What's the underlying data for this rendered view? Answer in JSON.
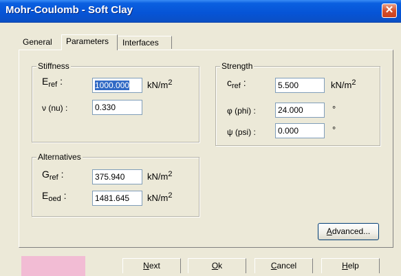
{
  "window": {
    "title": "Mohr-Coulomb - Soft Clay",
    "close_glyph": "✕"
  },
  "tabs": [
    {
      "label": "General"
    },
    {
      "label": "Parameters",
      "active": true
    },
    {
      "label": "Interfaces"
    }
  ],
  "stiffness": {
    "title": "Stiffness",
    "e_ref": {
      "symbol": "E",
      "sub": "ref",
      "value": "1000.000",
      "unit": "kN/m",
      "exp": "2"
    },
    "nu": {
      "label": "ν (nu) :",
      "value": "0.330"
    }
  },
  "strength": {
    "title": "Strength",
    "c_ref": {
      "symbol": "c",
      "sub": "ref",
      "value": "5.500",
      "unit": "kN/m",
      "exp": "2"
    },
    "phi": {
      "label": "φ (phi) :",
      "value": "24.000",
      "unit": "°"
    },
    "psi": {
      "label": "ψ (psi) :",
      "value": "0.000",
      "unit": "°"
    }
  },
  "alternatives": {
    "title": "Alternatives",
    "g_ref": {
      "symbol": "G",
      "sub": "ref",
      "value": "375.940",
      "unit": "kN/m",
      "exp": "2"
    },
    "e_oed": {
      "symbol": "E",
      "sub": "oed",
      "value": "1481.645",
      "unit": "kN/m",
      "exp": "2"
    }
  },
  "buttons": {
    "advanced": {
      "mnemonic": "A",
      "rest": "dvanced..."
    },
    "next": {
      "mnemonic": "N",
      "rest": "ext"
    },
    "ok": {
      "mnemonic": "O",
      "rest": "k"
    },
    "cancel": {
      "mnemonic": "C",
      "rest": "ancel"
    },
    "help": {
      "mnemonic": "H",
      "rest": "elp"
    }
  },
  "colors": {
    "material_color": "#f2bcd4",
    "titlebar": "#0654d6",
    "selection": "#316ac5"
  }
}
